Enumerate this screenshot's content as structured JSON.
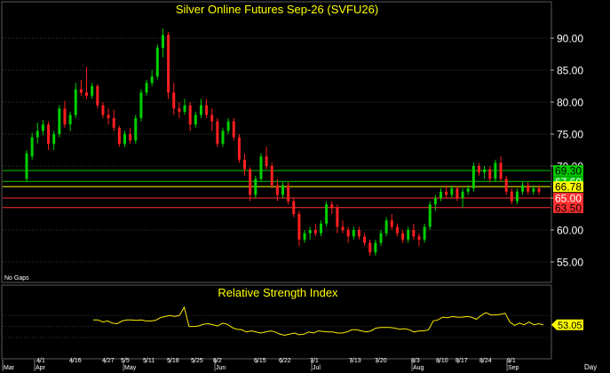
{
  "chart_data": [
    {
      "type": "candlestick",
      "title": "Silver Online Futures Sep-26 (SVFU26)",
      "note": "No Gaps",
      "ylim": [
        51.5,
        95
      ],
      "yticks": [
        55.0,
        60.0,
        65.0,
        70.0,
        75.0,
        80.0,
        85.0,
        90.0
      ],
      "ytick_labels": [
        "55.00",
        "60.00",
        "65.00",
        "70.00",
        "75.00",
        "80.00",
        "85.00",
        "90.00"
      ],
      "colors": {
        "up": "#00d000",
        "down": "#ff1f1f",
        "title": "#ffff00"
      },
      "horizontal_lines": [
        {
          "value": 69.3,
          "label": "69.30",
          "color": "#00c800",
          "label_bg": "#00c800",
          "label_color": "#000000"
        },
        {
          "value": 67.6,
          "label": "67.60",
          "color": "#00c800",
          "label_bg": "#00c800",
          "label_color": "#ffffff"
        },
        {
          "value": 66.78,
          "label": "66.78",
          "color": "#ffff00",
          "label_bg": "#ffff00",
          "label_color": "#000000"
        },
        {
          "value": 65.0,
          "label": "65.00",
          "color": "#ff3030",
          "label_bg": "#ff3030",
          "label_color": "#ffffff"
        },
        {
          "value": 63.5,
          "label": "63.50",
          "color": "#ff3030",
          "label_bg": "#ff3030",
          "label_color": "#000000"
        }
      ],
      "candles": [
        [
          68,
          72.5,
          67.5,
          72
        ],
        [
          71.5,
          75.2,
          71,
          74.5
        ],
        [
          74.5,
          76.8,
          73.5,
          75.5
        ],
        [
          75.5,
          77.2,
          74.8,
          76.5
        ],
        [
          76.5,
          77,
          72.5,
          73.5
        ],
        [
          73.5,
          75.5,
          72.5,
          75
        ],
        [
          75,
          79.5,
          74.5,
          79
        ],
        [
          79,
          80.2,
          76,
          76.5
        ],
        [
          76.5,
          78.5,
          75.5,
          78
        ],
        [
          78,
          83,
          77.5,
          82
        ],
        [
          82,
          83.5,
          81,
          81.5
        ],
        [
          81.5,
          85.5,
          80.5,
          81
        ],
        [
          81,
          83,
          80.5,
          82.5
        ],
        [
          82.5,
          82.8,
          79,
          79.5
        ],
        [
          79.5,
          80,
          77.5,
          78
        ],
        [
          78,
          79,
          76.5,
          77.5
        ],
        [
          77.5,
          78.8,
          75.5,
          76
        ],
        [
          76,
          76.3,
          73,
          73.5
        ],
        [
          73.5,
          75.5,
          73,
          75
        ],
        [
          75,
          76,
          73.5,
          74
        ],
        [
          74,
          78,
          73.5,
          77.5
        ],
        [
          77.5,
          82,
          77,
          81.5
        ],
        [
          81.5,
          83.5,
          81,
          83
        ],
        [
          83,
          85,
          82.5,
          84
        ],
        [
          84,
          89,
          83.5,
          88.5
        ],
        [
          88.5,
          91.5,
          87,
          90.5
        ],
        [
          90.5,
          91,
          80.5,
          81.5
        ],
        [
          81.5,
          83,
          78,
          79
        ],
        [
          79,
          80,
          77.5,
          78.5
        ],
        [
          78.5,
          80.5,
          78,
          79.5
        ],
        [
          79.5,
          80,
          75.5,
          76.5
        ],
        [
          76.5,
          78.5,
          76,
          78
        ],
        [
          78,
          80.5,
          77.5,
          79.5
        ],
        [
          79.5,
          80.5,
          77.5,
          78
        ],
        [
          78,
          79,
          75.5,
          77
        ],
        [
          77,
          77.5,
          73,
          73.5
        ],
        [
          73.5,
          76,
          73,
          75.5
        ],
        [
          75.5,
          77.5,
          75,
          77
        ],
        [
          77,
          77.5,
          74,
          74.5
        ],
        [
          74.5,
          75,
          70.5,
          71
        ],
        [
          71,
          72,
          68.5,
          69.5
        ],
        [
          69.5,
          69.8,
          64.5,
          65.5
        ],
        [
          65.5,
          68.5,
          65,
          68
        ],
        [
          68,
          72,
          67.5,
          71.5
        ],
        [
          71.5,
          73,
          69.5,
          70
        ],
        [
          70,
          70.5,
          66.5,
          67
        ],
        [
          67,
          68,
          64.5,
          65.5
        ],
        [
          65.5,
          67.5,
          65,
          67
        ],
        [
          67,
          67.5,
          64,
          64.5
        ],
        [
          64.5,
          65,
          62,
          62.5
        ],
        [
          62.5,
          63,
          57.5,
          58.5
        ],
        [
          58.5,
          60,
          58,
          59.5
        ],
        [
          59.5,
          60.5,
          58.5,
          60
        ],
        [
          60,
          61,
          59,
          59.5
        ],
        [
          59.5,
          61.5,
          59,
          61
        ],
        [
          61,
          64.5,
          60.5,
          64
        ],
        [
          64,
          64.5,
          62.5,
          63.5
        ],
        [
          63.5,
          64,
          59.5,
          60.5
        ],
        [
          60.5,
          61.5,
          59.5,
          60
        ],
        [
          60,
          60.5,
          58,
          59
        ],
        [
          59,
          60.5,
          58.5,
          60
        ],
        [
          60,
          60.5,
          58.5,
          59
        ],
        [
          59,
          59.5,
          57.5,
          58
        ],
        [
          58,
          58.5,
          56,
          56.5
        ],
        [
          56.5,
          58.5,
          56,
          58
        ],
        [
          58,
          60,
          57.5,
          59.5
        ],
        [
          59.5,
          62,
          59,
          61.5
        ],
        [
          61.5,
          62.5,
          60,
          60.5
        ],
        [
          60.5,
          61,
          59,
          59.5
        ],
        [
          59.5,
          60,
          58,
          58.5
        ],
        [
          58.5,
          60.5,
          58,
          60
        ],
        [
          60,
          61,
          58.5,
          59
        ],
        [
          59,
          59.5,
          57.5,
          58.5
        ],
        [
          58.5,
          61,
          58,
          60.5
        ],
        [
          60.5,
          64.5,
          60,
          64
        ],
        [
          64,
          65.5,
          63,
          65
        ],
        [
          65,
          66.5,
          64.5,
          66
        ],
        [
          66,
          67,
          65,
          65.5
        ],
        [
          65.5,
          67,
          65,
          66.5
        ],
        [
          66.5,
          66.8,
          64.5,
          65
        ],
        [
          65,
          66.5,
          63.5,
          66
        ],
        [
          66,
          67,
          65.5,
          66.5
        ],
        [
          66.5,
          70.5,
          66,
          70
        ],
        [
          70,
          70.5,
          68.5,
          69
        ],
        [
          69,
          70,
          68,
          69.5
        ],
        [
          69.5,
          70,
          67.5,
          68
        ],
        [
          68,
          71,
          67.5,
          70.5
        ],
        [
          70.5,
          71.5,
          67.5,
          68
        ],
        [
          68,
          68.5,
          65.5,
          66
        ],
        [
          66,
          66.5,
          64,
          64.5
        ],
        [
          64.5,
          66.5,
          64,
          66
        ],
        [
          66,
          67.5,
          65.5,
          67
        ],
        [
          67,
          67.5,
          65.5,
          66
        ],
        [
          66,
          67,
          65.5,
          66.5
        ],
        [
          66.5,
          67,
          65.5,
          66
        ]
      ]
    },
    {
      "type": "line",
      "title": "Relative Strength Index",
      "ylim": [
        0,
        100
      ],
      "last_label": "53.05",
      "color": "#ffee00",
      "values": [
        62,
        62,
        58,
        60,
        56,
        55,
        60,
        62,
        62,
        61,
        62,
        60,
        60,
        61,
        66,
        68,
        70,
        68,
        70,
        85,
        50,
        50,
        51,
        54,
        55,
        53,
        51,
        56,
        54,
        48,
        45,
        44,
        40,
        42,
        40,
        38,
        40,
        42,
        40,
        36,
        34,
        36,
        38,
        35,
        36,
        40,
        38,
        42,
        41,
        40,
        40,
        38,
        38,
        40,
        44,
        44,
        42,
        40,
        42,
        47,
        48,
        48,
        48,
        47,
        45,
        46,
        44,
        40,
        42,
        42,
        44,
        60,
        62,
        67,
        66,
        68,
        67,
        67,
        68,
        67,
        63,
        70,
        75,
        71,
        71,
        72,
        74,
        58,
        52,
        56,
        53,
        58,
        53,
        55,
        53
      ]
    }
  ],
  "x_axis": {
    "month_labels": [
      "Mar",
      "Apr",
      "May",
      "Jun",
      "Jul",
      "Aug",
      "Sep"
    ],
    "week_labels": [
      "4/1",
      "4/16",
      "4/27",
      "5/5",
      "5/11",
      "5/18",
      "5/25",
      "6/2",
      "6/15",
      "6/22",
      "7/1",
      "7/13",
      "7/20",
      "8/3",
      "8/10",
      "8/17",
      "8/24",
      "9/1"
    ],
    "corner_label": "Day"
  },
  "rsi_label_value": "53.05"
}
